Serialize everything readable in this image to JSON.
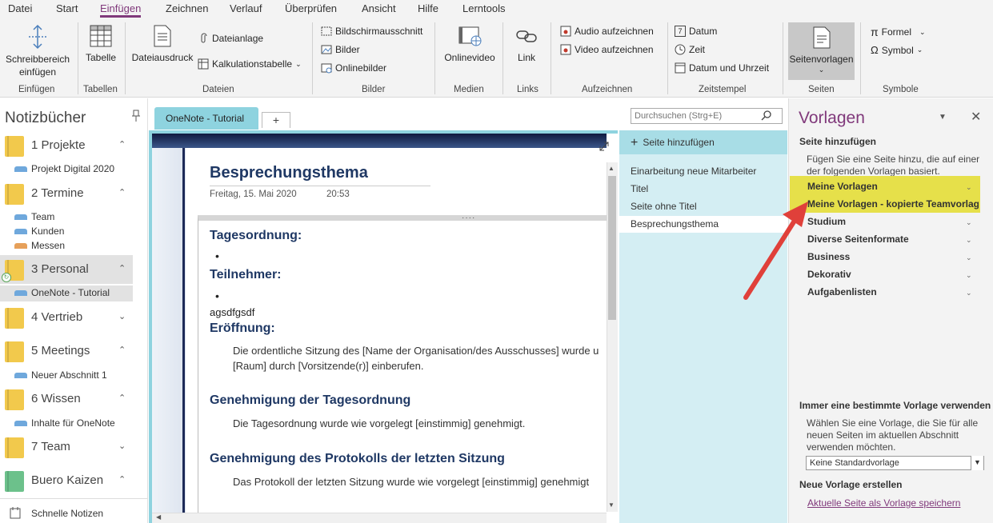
{
  "menu": {
    "tabs": [
      "Datei",
      "Start",
      "Einfügen",
      "Zeichnen",
      "Verlauf",
      "Überprüfen",
      "Ansicht",
      "Hilfe",
      "Lerntools"
    ],
    "active": "Einfügen"
  },
  "ribbon": {
    "insert_space": {
      "line1": "Schreibbereich",
      "line2": "einfügen",
      "group": "Einfügen"
    },
    "table": {
      "label": "Tabelle",
      "group": "Tabellen"
    },
    "files": {
      "printout": "Dateiausdruck",
      "attachment": "Dateianlage",
      "spreadsheet": "Kalkulationstabelle",
      "group": "Dateien"
    },
    "images": {
      "screenshot": "Bildschirmausschnitt",
      "pictures": "Bilder",
      "online_pictures": "Onlinebilder",
      "group": "Bilder"
    },
    "media": {
      "online_video": "Onlinevideo",
      "group": "Medien"
    },
    "links": {
      "link": "Link",
      "group": "Links"
    },
    "recording": {
      "audio": "Audio aufzeichnen",
      "video": "Video aufzeichnen",
      "group": "Aufzeichnen"
    },
    "timestamp": {
      "date": "Datum",
      "time": "Zeit",
      "date_time": "Datum und Uhrzeit",
      "date_icon_text": "7",
      "group": "Zeitstempel"
    },
    "pages": {
      "templates": "Seitenvorlagen",
      "group": "Seiten"
    },
    "symbols": {
      "formula": "Formel",
      "formula_icon": "π",
      "symbol": "Symbol",
      "symbol_icon": "Ω",
      "group": "Symbole"
    }
  },
  "sidebar": {
    "title": "Notizbücher",
    "notebooks": [
      {
        "label": "1 Projekte",
        "color": "#f2c94c",
        "sections": [
          {
            "label": "Projekt Digital 2020",
            "color": "#6fa8dc"
          }
        ]
      },
      {
        "label": "2 Termine",
        "color": "#f2c94c",
        "sections": [
          {
            "label": "Team",
            "color": "#6fa8dc"
          },
          {
            "label": "Kunden",
            "color": "#6fa8dc"
          },
          {
            "label": "Messen",
            "color": "#e6a05a"
          }
        ]
      },
      {
        "label": "3 Personal",
        "color": "#f2c94c",
        "sections": [
          {
            "label": "OneNote - Tutorial",
            "color": "#6fa8dc"
          }
        ]
      },
      {
        "label": "4 Vertrieb",
        "color": "#f2c94c",
        "sections": []
      },
      {
        "label": "5 Meetings",
        "color": "#f2c94c",
        "sections": [
          {
            "label": "Neuer Abschnitt 1",
            "color": "#6fa8dc"
          }
        ]
      },
      {
        "label": "6 Wissen",
        "color": "#f2c94c",
        "sections": [
          {
            "label": "Inhalte für OneNote",
            "color": "#6fa8dc"
          }
        ]
      },
      {
        "label": "7 Team",
        "color": "#f2c94c",
        "sections": []
      },
      {
        "label": "Buero Kaizen",
        "color": "#6cc18b",
        "sections": []
      }
    ],
    "quick_notes": "Schnelle Notizen"
  },
  "tabs": {
    "active": "OneNote - Tutorial",
    "add": "+"
  },
  "search": {
    "placeholder": "Durchsuchen (Strg+E)"
  },
  "page": {
    "title": "Besprechungsthema",
    "date": "Freitag, 15. Mai 2020",
    "time": "20:53",
    "dots": "····",
    "agenda": "Tagesordnung:",
    "bullet": "•",
    "participants": "Teilnehmer:",
    "typed": "agsdfgsdf",
    "opening": "Eröffnung:",
    "opening_l1": "Die ordentliche Sitzung des [Name der Organisation/des Ausschusses] wurde u",
    "opening_l2": "[Raum] durch [Vorsitzende(r)] einberufen.",
    "approval_agenda": "Genehmigung der Tagesordnung",
    "approval_agenda_text": "Die Tagesordnung wurde wie vorgelegt [einstimmig] genehmigt.",
    "approval_minutes": "Genehmigung des Protokolls der letzten Sitzung",
    "approval_minutes_text": "Das Protokoll der letzten Sitzung wurde wie vorgelegt [einstimmig] genehmigt"
  },
  "pagelist": {
    "add": "Seite hinzufügen",
    "items": [
      "Einarbeitung neue Mitarbeiter",
      "Titel",
      "Seite ohne Titel",
      "Besprechungsthema"
    ],
    "selected": "Besprechungsthema"
  },
  "templates": {
    "title": "Vorlagen",
    "add_page_heading": "Seite hinzufügen",
    "add_page_desc": "Fügen Sie eine Seite hinzu, die auf einer der folgenden Vorlagen basiert.",
    "categories": [
      "Meine Vorlagen",
      "Meine Vorlagen - kopierte Teamvorlage",
      "Studium",
      "Diverse Seitenformate",
      "Business",
      "Dekorativ",
      "Aufgabenlisten"
    ],
    "highlight_color": "#e6e04a",
    "always_heading": "Immer eine bestimmte Vorlage verwenden",
    "always_desc": "Wählen Sie eine Vorlage, die Sie für alle neuen Seiten im aktuellen Abschnitt verwenden möchten.",
    "default_select": "Keine Standardvorlage",
    "new_heading": "Neue Vorlage erstellen",
    "save_link": "Aktuelle Seite als Vorlage speichern"
  }
}
